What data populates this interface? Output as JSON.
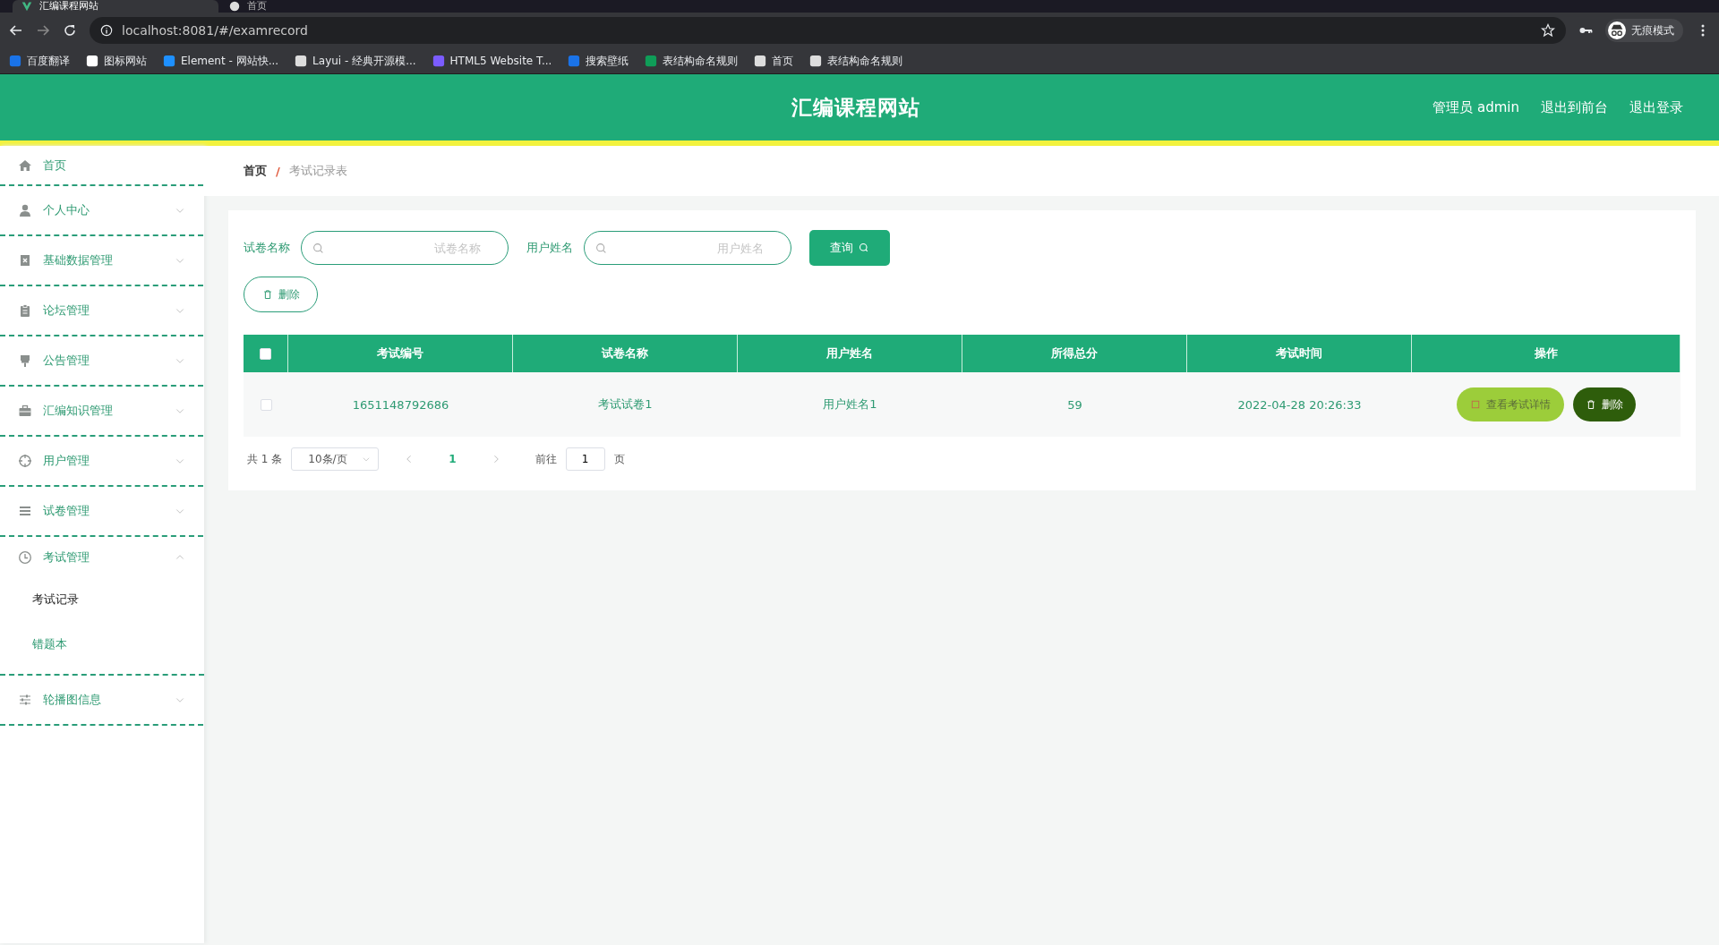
{
  "browser": {
    "tabs": [
      {
        "title": "汇编课程网站",
        "selected": true
      },
      {
        "title": "首页",
        "selected": false
      }
    ],
    "url": "localhost:8081/#/examrecord",
    "profile": "无痕模式",
    "bookmarks": [
      "百度翻译",
      "图标网站",
      "Element - 网站快...",
      "Layui - 经典开源模...",
      "HTML5 Website T...",
      "搜索壁纸",
      "表结构命名规则",
      "首页",
      "表结构命名规则"
    ]
  },
  "header": {
    "title": "汇编课程网站",
    "links": [
      "管理员 admin",
      "退出到前台",
      "退出登录"
    ]
  },
  "sidebar": {
    "items": [
      {
        "label": "首页"
      },
      {
        "label": "个人中心",
        "expanded": false
      },
      {
        "label": "基础数据管理",
        "expanded": false
      },
      {
        "label": "论坛管理",
        "expanded": false
      },
      {
        "label": "公告管理",
        "expanded": false
      },
      {
        "label": "汇编知识管理",
        "expanded": false
      },
      {
        "label": "用户管理",
        "expanded": false
      },
      {
        "label": "试卷管理",
        "expanded": false
      },
      {
        "label": "考试管理",
        "expanded": true,
        "children": [
          {
            "label": "考试记录",
            "selected": true
          },
          {
            "label": "错题本",
            "selected": false
          }
        ]
      },
      {
        "label": "轮播图信息",
        "expanded": false
      }
    ]
  },
  "breadcrumb": {
    "items": [
      "首页",
      "考试记录表"
    ],
    "separator": "/"
  },
  "search": {
    "fields": [
      {
        "label": "试卷名称",
        "placeholder": "试卷名称"
      },
      {
        "label": "用户姓名",
        "placeholder": "用户姓名"
      }
    ],
    "button": "查询"
  },
  "delete_button": "删除",
  "table": {
    "all_checked": false,
    "columns": [
      "考试编号",
      "试卷名称",
      "用户姓名",
      "所得总分",
      "考试时间",
      "操作"
    ],
    "rows": [
      {
        "checked": false,
        "cells": [
          "1651148792686",
          "考试试卷1",
          "用户姓名1",
          "59",
          "2022-04-28 20:26:33"
        ],
        "actions": [
          {
            "kind": "detail",
            "label": "查看考试详情"
          },
          {
            "kind": "delete",
            "label": "删除"
          }
        ]
      }
    ]
  },
  "pagination": {
    "total": "共 1 条",
    "page_size": "10条/页",
    "pages": [
      {
        "label": "1",
        "selected": true
      }
    ],
    "goto_label": "前往",
    "goto_value": "1",
    "goto_suffix": "页"
  }
}
